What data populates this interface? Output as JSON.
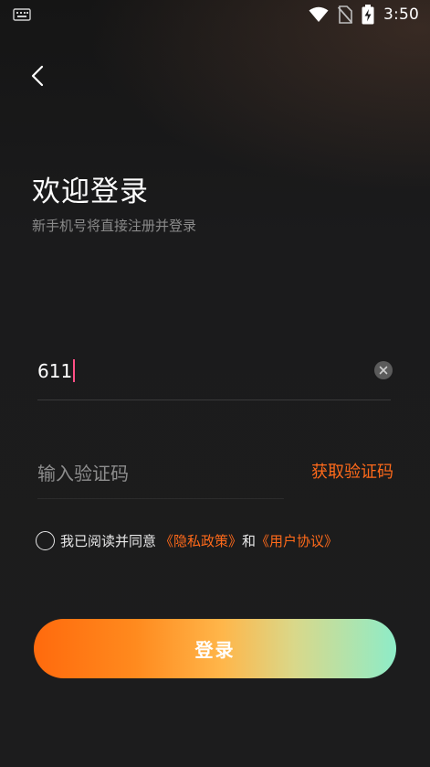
{
  "status_bar": {
    "time": "3:50",
    "icons": [
      "keyboard-icon",
      "wifi-icon",
      "no-sim-icon",
      "battery-charging-icon"
    ]
  },
  "header": {
    "back_icon": "chevron-left-icon"
  },
  "login": {
    "title": "欢迎登录",
    "subtitle": "新手机号将直接注册并登录",
    "phone_value": "611",
    "code_placeholder": "输入验证码",
    "get_code_label": "获取验证码",
    "agreement_prefix": "我已阅读并同意",
    "privacy_link": "《隐私政策》",
    "agreement_and": "和",
    "terms_link": "《用户协议》",
    "submit_label": "登录"
  },
  "colors": {
    "accent": "#ff6a1a",
    "caret": "#ff4f86",
    "gradient_start": "#ff6a0d",
    "gradient_end": "#8eecc8"
  }
}
